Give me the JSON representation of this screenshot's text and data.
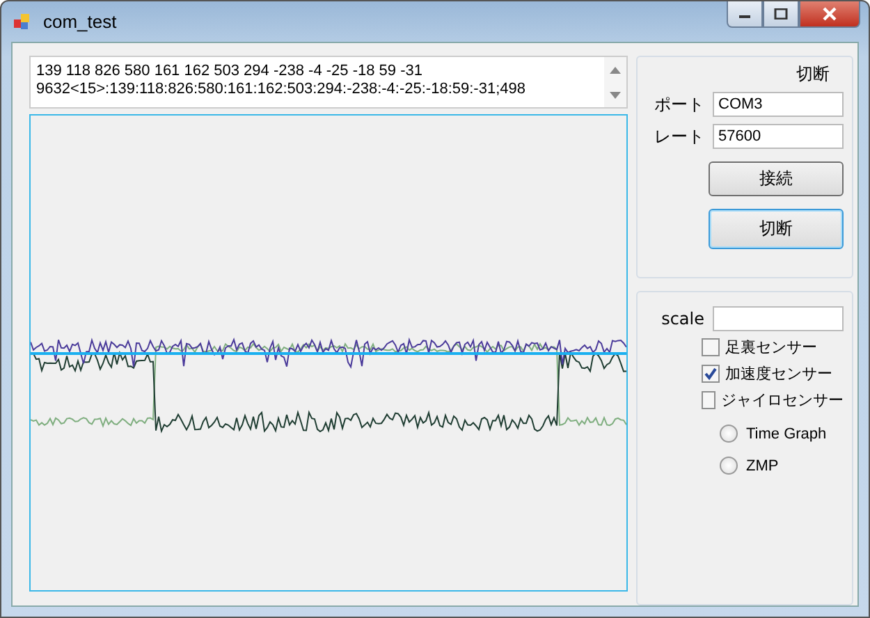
{
  "window": {
    "title": "com_test"
  },
  "log": {
    "lines": [
      "139 118 826 580 161 162 503 294 -238 -4 -25 -18 59 -31",
      "9632<15>:139:118:826:580:161:162:503:294:-238:-4:-25:-18:59:-31;498"
    ]
  },
  "connection": {
    "status": "切断",
    "port_label": "ポート",
    "port_value": "COM3",
    "rate_label": "レート",
    "rate_value": "57600",
    "buttons": [
      {
        "label": "接続",
        "focused": false
      },
      {
        "label": "切断",
        "focused": true
      }
    ]
  },
  "display": {
    "scale_label": "scale",
    "sensors": [
      {
        "label": "足裏センサー",
        "checked": false
      },
      {
        "label": "加速度センサー",
        "checked": true
      },
      {
        "label": "ジャイロセンサー",
        "checked": false
      }
    ],
    "modes": [
      {
        "label": "Time Graph",
        "selected": false
      },
      {
        "label": "ZMP",
        "selected": false
      }
    ]
  }
}
